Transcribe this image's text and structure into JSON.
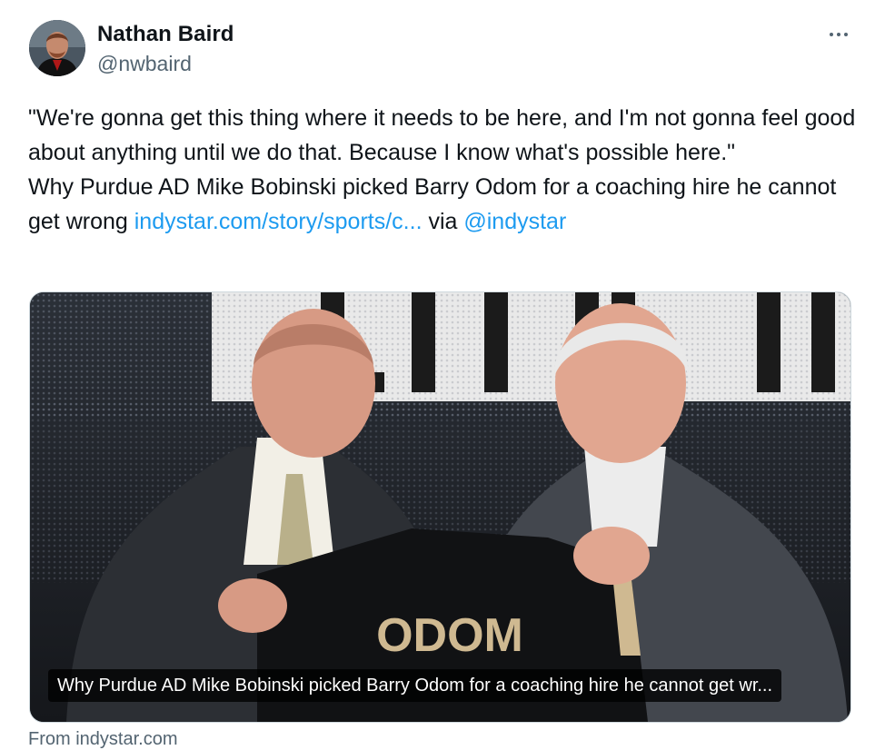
{
  "author": {
    "name": "Nathan Baird",
    "handle": "@nwbaird",
    "avatar_icon": "profile-photo"
  },
  "more_icon": "more-horizontal-icon",
  "tweet": {
    "line1": "\"We're gonna get this thing where it needs to be here, and I'm not gonna feel good about anything until we do that. Because I know what's possible here.\"",
    "line2_text": "Why Purdue AD Mike Bobinski picked Barry Odom for a coaching hire he cannot get wrong ",
    "link": "indystar.com/story/sports/c...",
    "via": " via ",
    "mention": "@indystar"
  },
  "card": {
    "caption": "Why Purdue AD Mike Bobinski picked Barry Odom for a coaching hire he cannot get wr...",
    "jersey_name": "ODOM",
    "source": "From indystar.com"
  },
  "colors": {
    "link": "#1d9bf0",
    "secondary_text": "#536471",
    "jersey_gold": "#cfb991"
  }
}
